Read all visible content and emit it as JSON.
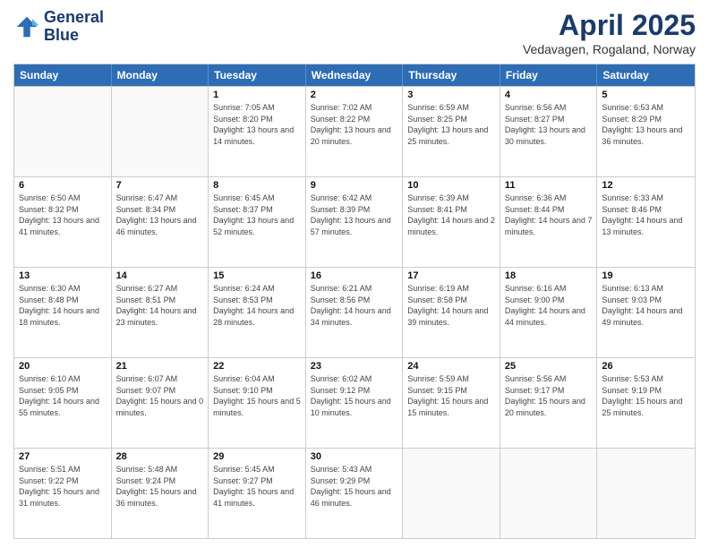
{
  "header": {
    "logo_line1": "General",
    "logo_line2": "Blue",
    "main_title": "April 2025",
    "subtitle": "Vedavagen, Rogaland, Norway"
  },
  "days_of_week": [
    "Sunday",
    "Monday",
    "Tuesday",
    "Wednesday",
    "Thursday",
    "Friday",
    "Saturday"
  ],
  "weeks": [
    [
      {
        "day": "",
        "content": ""
      },
      {
        "day": "",
        "content": ""
      },
      {
        "day": "1",
        "content": "Sunrise: 7:05 AM\nSunset: 8:20 PM\nDaylight: 13 hours and 14 minutes."
      },
      {
        "day": "2",
        "content": "Sunrise: 7:02 AM\nSunset: 8:22 PM\nDaylight: 13 hours and 20 minutes."
      },
      {
        "day": "3",
        "content": "Sunrise: 6:59 AM\nSunset: 8:25 PM\nDaylight: 13 hours and 25 minutes."
      },
      {
        "day": "4",
        "content": "Sunrise: 6:56 AM\nSunset: 8:27 PM\nDaylight: 13 hours and 30 minutes."
      },
      {
        "day": "5",
        "content": "Sunrise: 6:53 AM\nSunset: 8:29 PM\nDaylight: 13 hours and 36 minutes."
      }
    ],
    [
      {
        "day": "6",
        "content": "Sunrise: 6:50 AM\nSunset: 8:32 PM\nDaylight: 13 hours and 41 minutes."
      },
      {
        "day": "7",
        "content": "Sunrise: 6:47 AM\nSunset: 8:34 PM\nDaylight: 13 hours and 46 minutes."
      },
      {
        "day": "8",
        "content": "Sunrise: 6:45 AM\nSunset: 8:37 PM\nDaylight: 13 hours and 52 minutes."
      },
      {
        "day": "9",
        "content": "Sunrise: 6:42 AM\nSunset: 8:39 PM\nDaylight: 13 hours and 57 minutes."
      },
      {
        "day": "10",
        "content": "Sunrise: 6:39 AM\nSunset: 8:41 PM\nDaylight: 14 hours and 2 minutes."
      },
      {
        "day": "11",
        "content": "Sunrise: 6:36 AM\nSunset: 8:44 PM\nDaylight: 14 hours and 7 minutes."
      },
      {
        "day": "12",
        "content": "Sunrise: 6:33 AM\nSunset: 8:46 PM\nDaylight: 14 hours and 13 minutes."
      }
    ],
    [
      {
        "day": "13",
        "content": "Sunrise: 6:30 AM\nSunset: 8:48 PM\nDaylight: 14 hours and 18 minutes."
      },
      {
        "day": "14",
        "content": "Sunrise: 6:27 AM\nSunset: 8:51 PM\nDaylight: 14 hours and 23 minutes."
      },
      {
        "day": "15",
        "content": "Sunrise: 6:24 AM\nSunset: 8:53 PM\nDaylight: 14 hours and 28 minutes."
      },
      {
        "day": "16",
        "content": "Sunrise: 6:21 AM\nSunset: 8:56 PM\nDaylight: 14 hours and 34 minutes."
      },
      {
        "day": "17",
        "content": "Sunrise: 6:19 AM\nSunset: 8:58 PM\nDaylight: 14 hours and 39 minutes."
      },
      {
        "day": "18",
        "content": "Sunrise: 6:16 AM\nSunset: 9:00 PM\nDaylight: 14 hours and 44 minutes."
      },
      {
        "day": "19",
        "content": "Sunrise: 6:13 AM\nSunset: 9:03 PM\nDaylight: 14 hours and 49 minutes."
      }
    ],
    [
      {
        "day": "20",
        "content": "Sunrise: 6:10 AM\nSunset: 9:05 PM\nDaylight: 14 hours and 55 minutes."
      },
      {
        "day": "21",
        "content": "Sunrise: 6:07 AM\nSunset: 9:07 PM\nDaylight: 15 hours and 0 minutes."
      },
      {
        "day": "22",
        "content": "Sunrise: 6:04 AM\nSunset: 9:10 PM\nDaylight: 15 hours and 5 minutes."
      },
      {
        "day": "23",
        "content": "Sunrise: 6:02 AM\nSunset: 9:12 PM\nDaylight: 15 hours and 10 minutes."
      },
      {
        "day": "24",
        "content": "Sunrise: 5:59 AM\nSunset: 9:15 PM\nDaylight: 15 hours and 15 minutes."
      },
      {
        "day": "25",
        "content": "Sunrise: 5:56 AM\nSunset: 9:17 PM\nDaylight: 15 hours and 20 minutes."
      },
      {
        "day": "26",
        "content": "Sunrise: 5:53 AM\nSunset: 9:19 PM\nDaylight: 15 hours and 25 minutes."
      }
    ],
    [
      {
        "day": "27",
        "content": "Sunrise: 5:51 AM\nSunset: 9:22 PM\nDaylight: 15 hours and 31 minutes."
      },
      {
        "day": "28",
        "content": "Sunrise: 5:48 AM\nSunset: 9:24 PM\nDaylight: 15 hours and 36 minutes."
      },
      {
        "day": "29",
        "content": "Sunrise: 5:45 AM\nSunset: 9:27 PM\nDaylight: 15 hours and 41 minutes."
      },
      {
        "day": "30",
        "content": "Sunrise: 5:43 AM\nSunset: 9:29 PM\nDaylight: 15 hours and 46 minutes."
      },
      {
        "day": "",
        "content": ""
      },
      {
        "day": "",
        "content": ""
      },
      {
        "day": "",
        "content": ""
      }
    ]
  ]
}
